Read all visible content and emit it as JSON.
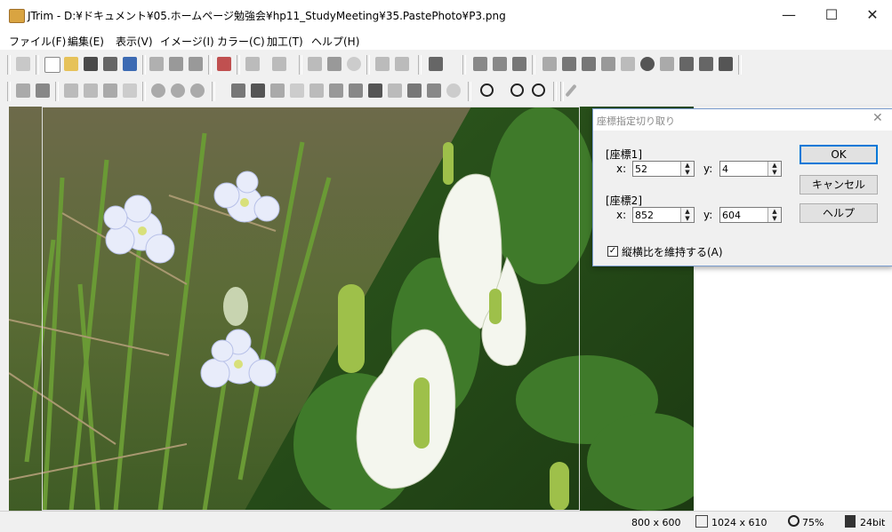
{
  "window": {
    "title": "JTrim - D:¥ドキュメント¥05.ホームページ勉強会¥hp11_StudyMeeting¥35.PastePhoto¥P3.png",
    "minimize": "—",
    "maximize": "☐",
    "close": "✕"
  },
  "menu": [
    "ファイル(F)",
    "編集(E)",
    "表示(V)",
    "イメージ(I)",
    "カラー(C)",
    "加工(T)",
    "ヘルプ(H)"
  ],
  "dialog": {
    "title": "座標指定切り取り",
    "close": "✕",
    "coord1_label": "[座標1]",
    "coord2_label": "[座標2]",
    "x_label": "x:",
    "y_label": "y:",
    "x1": "52",
    "y1": "4",
    "x2": "852",
    "y2": "604",
    "ok": "OK",
    "cancel": "キャンセル",
    "help": "ヘルプ",
    "keep_ratio": "縦横比を維持する(A)",
    "keep_ratio_checked": true
  },
  "status": {
    "selection_size": "800 x 600",
    "image_size": "1024 x 610",
    "zoom": "75%",
    "depth": "24bit"
  }
}
